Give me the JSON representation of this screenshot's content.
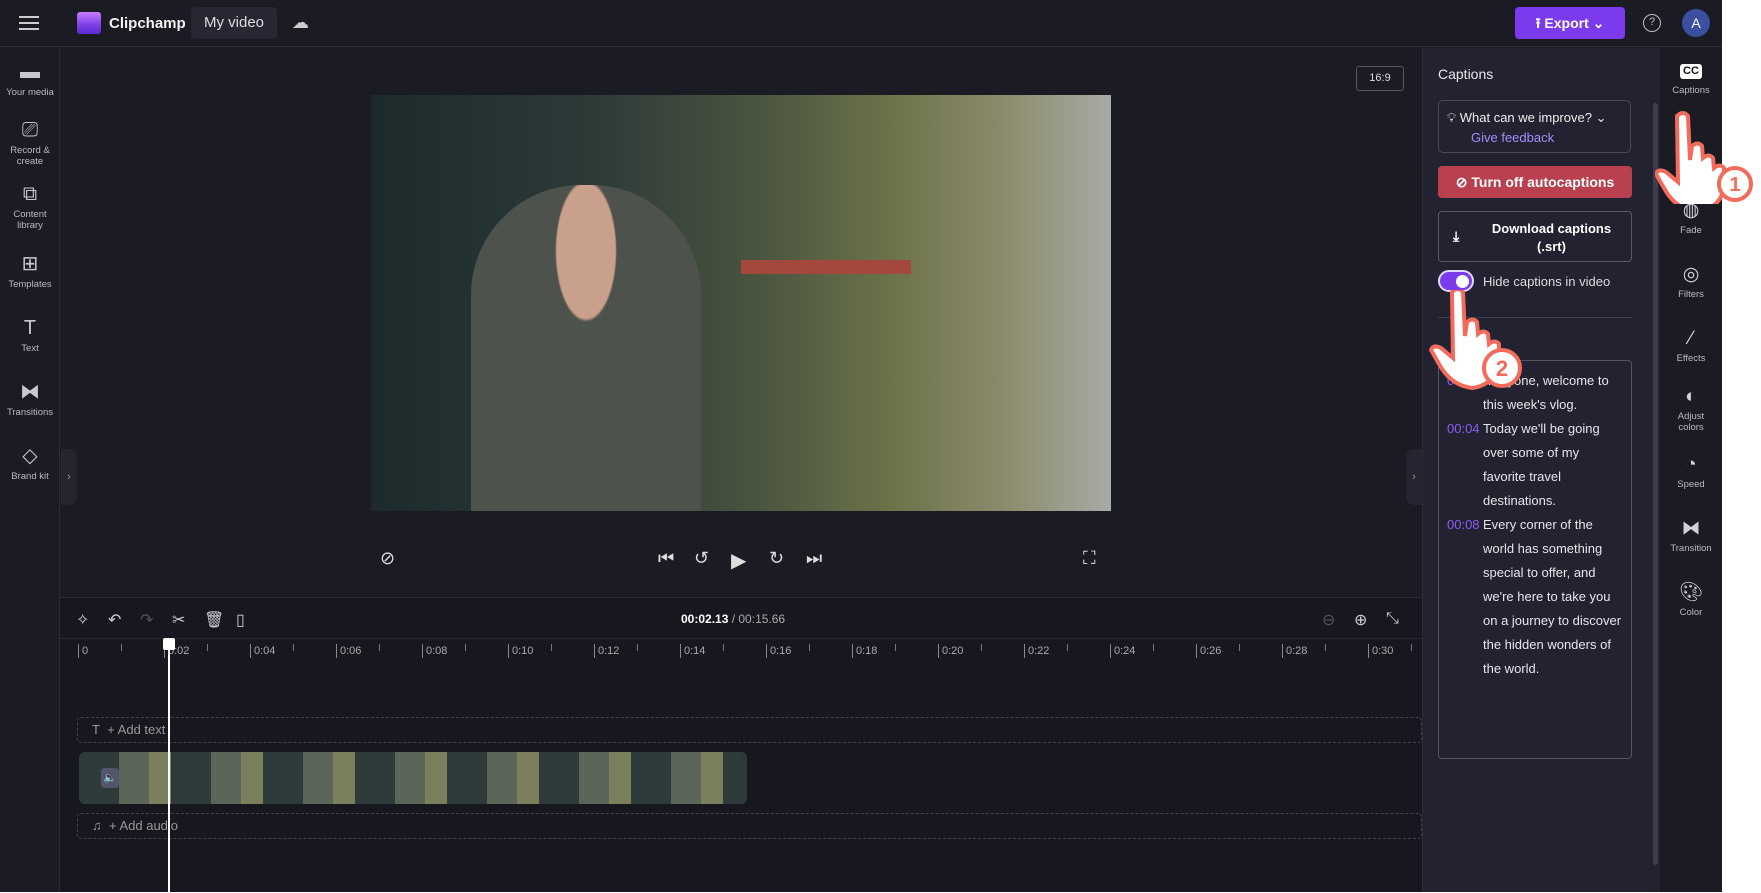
{
  "topbar": {
    "app_name": "Clipchamp",
    "project_name": "My video",
    "export_label": "Export",
    "help": "?",
    "avatar": "A"
  },
  "leftnav": [
    {
      "label": "Your media",
      "icon": "folder-icon"
    },
    {
      "label": "Record & create",
      "icon": "camera-icon"
    },
    {
      "label": "Content library",
      "icon": "library-icon"
    },
    {
      "label": "Templates",
      "icon": "templates-icon"
    },
    {
      "label": "Text",
      "icon": "text-icon"
    },
    {
      "label": "Transitions",
      "icon": "transitions-icon"
    },
    {
      "label": "Brand kit",
      "icon": "brand-kit-icon"
    }
  ],
  "preview": {
    "aspect_ratio": "16:9"
  },
  "timeline": {
    "current_time": "00:02.13",
    "total_time": "/ 00:15.66",
    "ticks": [
      "0",
      "0:02",
      "0:04",
      "0:06",
      "0:08",
      "0:10",
      "0:12",
      "0:14",
      "0:16",
      "0:18",
      "0:20",
      "0:22",
      "0:24",
      "0:26",
      "0:28",
      "0:30"
    ],
    "add_text": "+ Add text",
    "add_audio": "+ Add audio"
  },
  "captions_panel": {
    "title": "Captions",
    "feedback_question": "What can we improve?",
    "feedback_link": "Give feedback",
    "turn_off_label": "Turn off autocaptions",
    "download_label": "Download captions (.srt)",
    "toggle_label": "Hide captions in video",
    "toggle_on": true,
    "transcript": [
      {
        "time": "00:01",
        "text": "…eryone, welcome to this week's vlog."
      },
      {
        "time": "00:04",
        "text": "Today we'll be going over some of my favorite travel destinations."
      },
      {
        "time": "00:08",
        "text": "Every corner of the world has something special to offer, and we're here to take you on a journey to discover the hidden wonders of the world."
      }
    ]
  },
  "rightnav": [
    {
      "label": "Captions",
      "icon": "cc-icon"
    },
    {
      "label": "Fade",
      "icon": "fade-icon"
    },
    {
      "label": "Filters",
      "icon": "filters-icon"
    },
    {
      "label": "Effects",
      "icon": "effects-icon"
    },
    {
      "label": "Adjust colors",
      "icon": "adjust-colors-icon"
    },
    {
      "label": "Speed",
      "icon": "speed-icon"
    },
    {
      "label": "Transition",
      "icon": "transition-icon"
    },
    {
      "label": "Color",
      "icon": "color-icon"
    }
  ],
  "annotations": {
    "step1": "1",
    "step2": "2"
  },
  "colors": {
    "accent": "#7c3aed",
    "danger": "#b8404f",
    "annotation": "#f26b5b"
  }
}
